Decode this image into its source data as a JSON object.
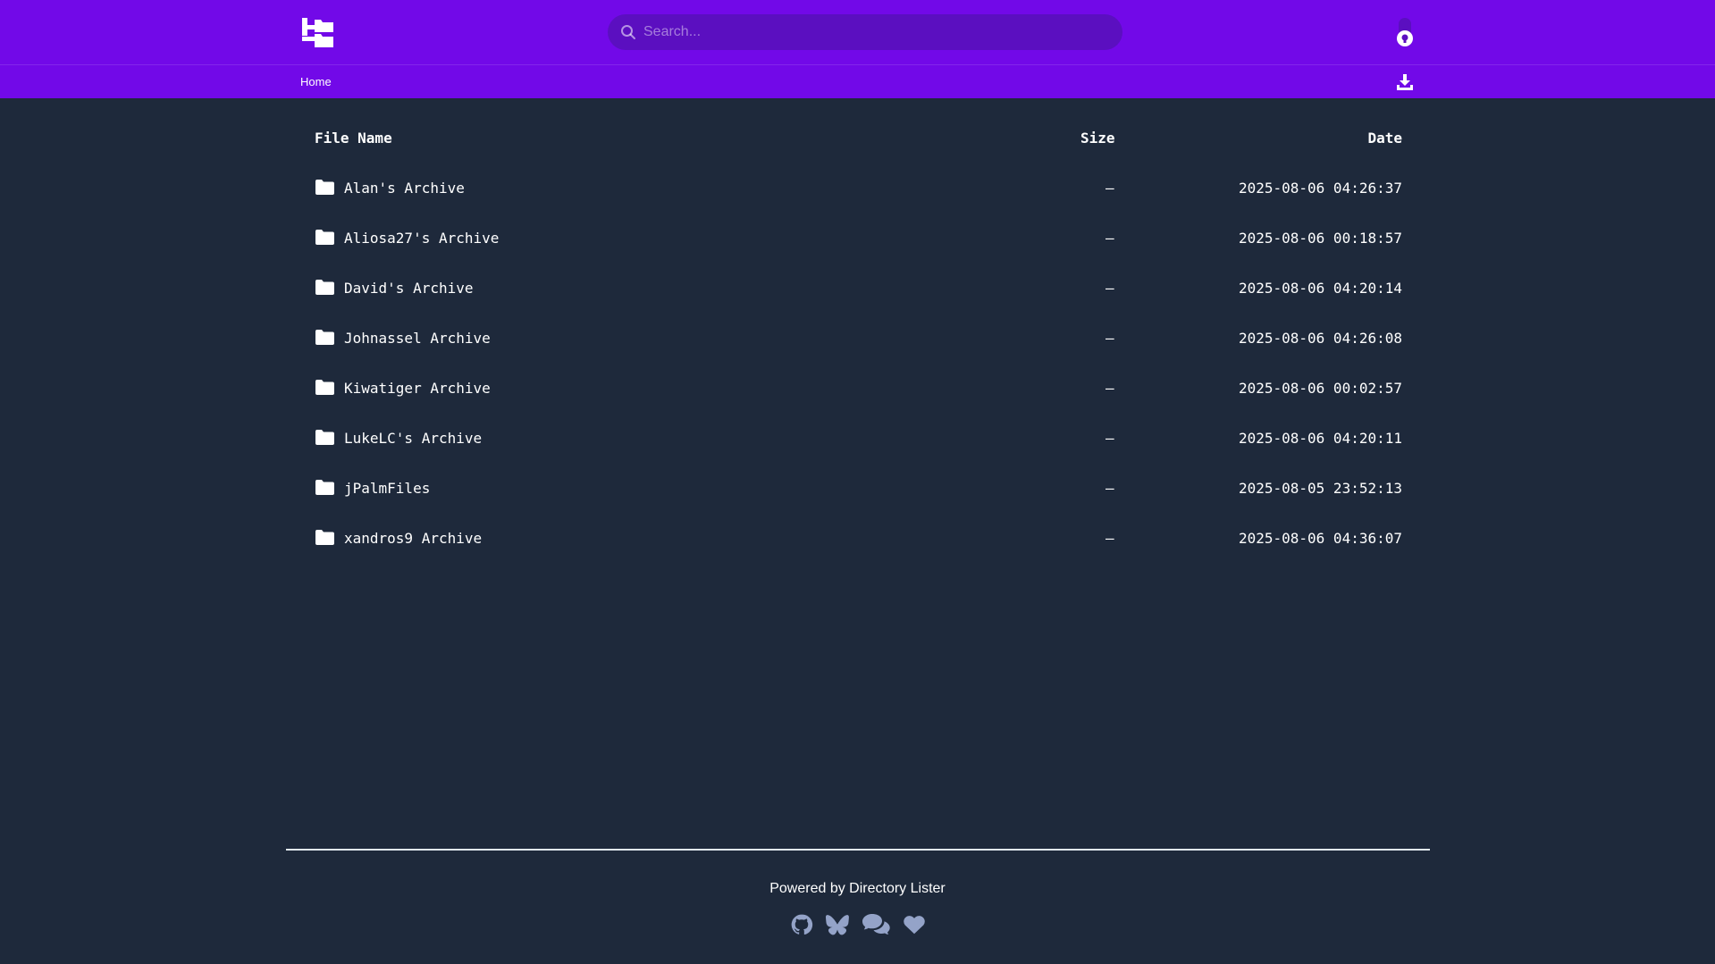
{
  "header": {
    "logo_icon": "directory-tree-logo",
    "search": {
      "placeholder": "Search...",
      "value": ""
    },
    "theme_toggle_icon": "lightbulb-toggle-icon",
    "accent_color": "#7209e8"
  },
  "breadcrumb": {
    "items": [
      "Home"
    ]
  },
  "toolbar": {
    "download_icon": "download-icon"
  },
  "table": {
    "columns": {
      "name": "File Name",
      "size": "Size",
      "date": "Date"
    },
    "rows": [
      {
        "icon": "folder-icon",
        "name": "Alan's Archive",
        "size": "—",
        "date": "2025-08-06 04:26:37"
      },
      {
        "icon": "folder-icon",
        "name": "Aliosa27's Archive",
        "size": "—",
        "date": "2025-08-06 00:18:57"
      },
      {
        "icon": "folder-icon",
        "name": "David's Archive",
        "size": "—",
        "date": "2025-08-06 04:20:14"
      },
      {
        "icon": "folder-icon",
        "name": "Johnassel Archive",
        "size": "—",
        "date": "2025-08-06 04:26:08"
      },
      {
        "icon": "folder-icon",
        "name": "Kiwatiger Archive",
        "size": "—",
        "date": "2025-08-06 00:02:57"
      },
      {
        "icon": "folder-icon",
        "name": "LukeLC's Archive",
        "size": "—",
        "date": "2025-08-06 04:20:11"
      },
      {
        "icon": "folder-icon",
        "name": "jPalmFiles",
        "size": "—",
        "date": "2025-08-05 23:52:13"
      },
      {
        "icon": "folder-icon",
        "name": "xandros9 Archive",
        "size": "—",
        "date": "2025-08-06 04:36:07"
      }
    ]
  },
  "footer": {
    "powered_by": "Powered by Directory Lister",
    "icons": [
      "github-icon",
      "butterfly-icon",
      "chat-icon",
      "heart-icon"
    ]
  }
}
